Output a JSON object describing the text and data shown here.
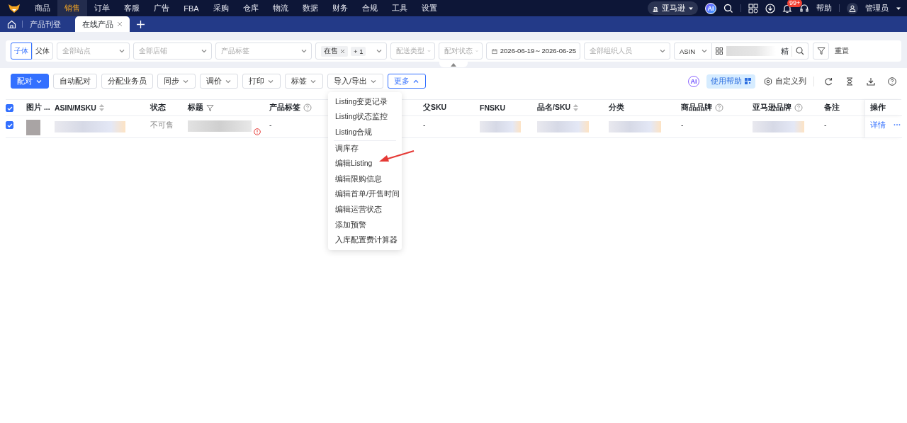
{
  "top_nav": {
    "items": [
      {
        "label": "商品",
        "selected": false
      },
      {
        "label": "销售",
        "selected": true
      },
      {
        "label": "订单",
        "selected": false
      },
      {
        "label": "客服",
        "selected": false
      },
      {
        "label": "广告",
        "selected": false
      },
      {
        "label": "FBA",
        "selected": false
      },
      {
        "label": "采购",
        "selected": false
      },
      {
        "label": "仓库",
        "selected": false
      },
      {
        "label": "物流",
        "selected": false
      },
      {
        "label": "数据",
        "selected": false
      },
      {
        "label": "财务",
        "selected": false
      },
      {
        "label": "合规",
        "selected": false
      },
      {
        "label": "工具",
        "selected": false
      },
      {
        "label": "设置",
        "selected": false
      }
    ],
    "platform": "亚马逊",
    "ai": "AI",
    "notification_badge": "99+",
    "help": "帮助",
    "user": "管理员"
  },
  "tabs": [
    {
      "label": "产品刊登",
      "selected": false
    },
    {
      "label": "在线产品",
      "selected": true
    }
  ],
  "filters": {
    "variant_toggle": [
      {
        "label": "子体",
        "selected": true
      },
      {
        "label": "父体",
        "selected": false
      }
    ],
    "site": {
      "placeholder": "全部站点"
    },
    "store": {
      "placeholder": "全部店铺"
    },
    "product_tag": {
      "placeholder": "产品标签"
    },
    "status": {
      "tags": [
        "在售"
      ],
      "more": "+ 1"
    },
    "fulfillment": {
      "placeholder": "配送类型"
    },
    "pairing_status": {
      "placeholder": "配对状态"
    },
    "date_range": "2026-06-19～2026-06-25",
    "staff": {
      "placeholder": "全部组织人员"
    },
    "search_type": "ASIN",
    "search_mode": "精",
    "reset": "重置"
  },
  "toolbar": {
    "buttons": [
      {
        "label": "配对",
        "kind": "primary_dropdown",
        "expanded": false
      },
      {
        "label": "自动配对",
        "kind": "plain",
        "expanded": false
      },
      {
        "label": "分配业务员",
        "kind": "plain",
        "expanded": false
      },
      {
        "label": "同步",
        "kind": "dropdown",
        "expanded": false
      },
      {
        "label": "调价",
        "kind": "dropdown",
        "expanded": false
      },
      {
        "label": "打印",
        "kind": "dropdown",
        "expanded": false
      },
      {
        "label": "标签",
        "kind": "dropdown",
        "expanded": false
      },
      {
        "label": "导入/导出",
        "kind": "dropdown",
        "expanded": false
      },
      {
        "label": "更多",
        "kind": "dropdown",
        "expanded": true
      }
    ],
    "ai": "AI",
    "help_button": "使用帮助",
    "custom_columns": "自定义列"
  },
  "table": {
    "all_checked": true,
    "columns": [
      "图片 ...",
      "ASIN/MSKU",
      "状态",
      "标题",
      "产品标签",
      "父SKU",
      "FNSKU",
      "品名/SKU",
      "分类",
      "商品品牌",
      "亚马逊品牌",
      "备注",
      "操作"
    ],
    "rows": [
      {
        "checked": true,
        "cells": [
          {
            "kind": "image"
          },
          {
            "kind": "redacted"
          },
          {
            "kind": "text",
            "text": "不可售"
          },
          {
            "kind": "redacted_warning"
          },
          {
            "kind": "text",
            "text": "-"
          },
          {
            "kind": "text",
            "text": "-"
          },
          {
            "kind": "redacted"
          },
          {
            "kind": "redacted"
          },
          {
            "kind": "redacted"
          },
          {
            "kind": "text",
            "text": "-"
          },
          {
            "kind": "redacted"
          },
          {
            "kind": "text",
            "text": "-"
          },
          {
            "kind": "actions",
            "link": "详情",
            "more": "···"
          }
        ]
      }
    ]
  },
  "more_menu": {
    "sections": [
      [
        "Listing变更记录",
        "Listing状态监控",
        "Listing合规"
      ],
      [
        "调库存",
        "编辑Listing",
        "编辑限购信息",
        "编辑首单/开售时间",
        "编辑运营状态",
        "添加预警",
        "入库配置费计算器"
      ]
    ]
  }
}
